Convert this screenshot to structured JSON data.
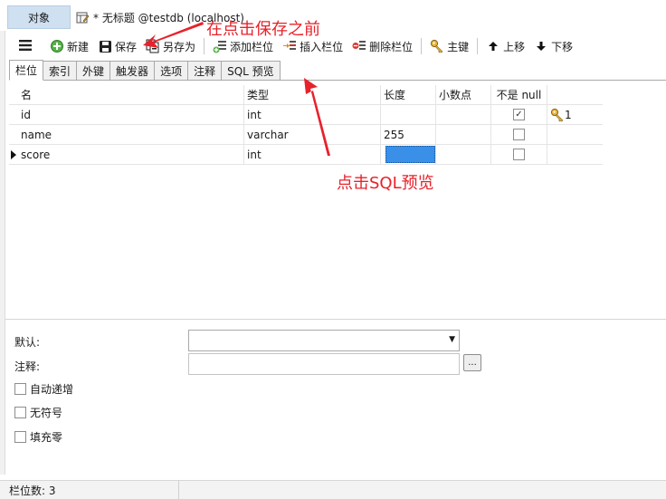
{
  "tabs": {
    "objects_label": "对象",
    "doc_title": "* 无标题 @testdb (localhost)..."
  },
  "toolbar": {
    "new_label": "新建",
    "save_label": "保存",
    "save_as_label": "另存为",
    "add_field_label": "添加栏位",
    "insert_field_label": "插入栏位",
    "delete_field_label": "删除栏位",
    "primary_key_label": "主键",
    "move_up_label": "上移",
    "move_down_label": "下移"
  },
  "subtabs": [
    "栏位",
    "索引",
    "外键",
    "触发器",
    "选项",
    "注释",
    "SQL 预览"
  ],
  "grid": {
    "headers": {
      "name": "名",
      "type": "类型",
      "length": "长度",
      "decimals": "小数点",
      "not_null": "不是 null"
    },
    "rows": [
      {
        "name": "id",
        "type": "int",
        "length": "",
        "decimals": "",
        "not_null": true,
        "key": "1"
      },
      {
        "name": "name",
        "type": "varchar",
        "length": "255",
        "decimals": "",
        "not_null": false,
        "key": ""
      },
      {
        "name": "score",
        "type": "int",
        "length": "",
        "decimals": "",
        "not_null": false,
        "key": ""
      }
    ]
  },
  "props": {
    "default_label": "默认:",
    "comment_label": "注释:",
    "auto_increment_label": "自动递增",
    "unsigned_label": "无符号",
    "zerofill_label": "填充零",
    "dots_label": "..."
  },
  "status": {
    "field_count": "栏位数: 3"
  },
  "annotations": {
    "top": "在点击保存之前",
    "middle": "点击SQL预览"
  },
  "colors": {
    "accent": "#3a8fe8",
    "annotation": "#e8212a",
    "objects_tab": "#cfe0f1"
  }
}
